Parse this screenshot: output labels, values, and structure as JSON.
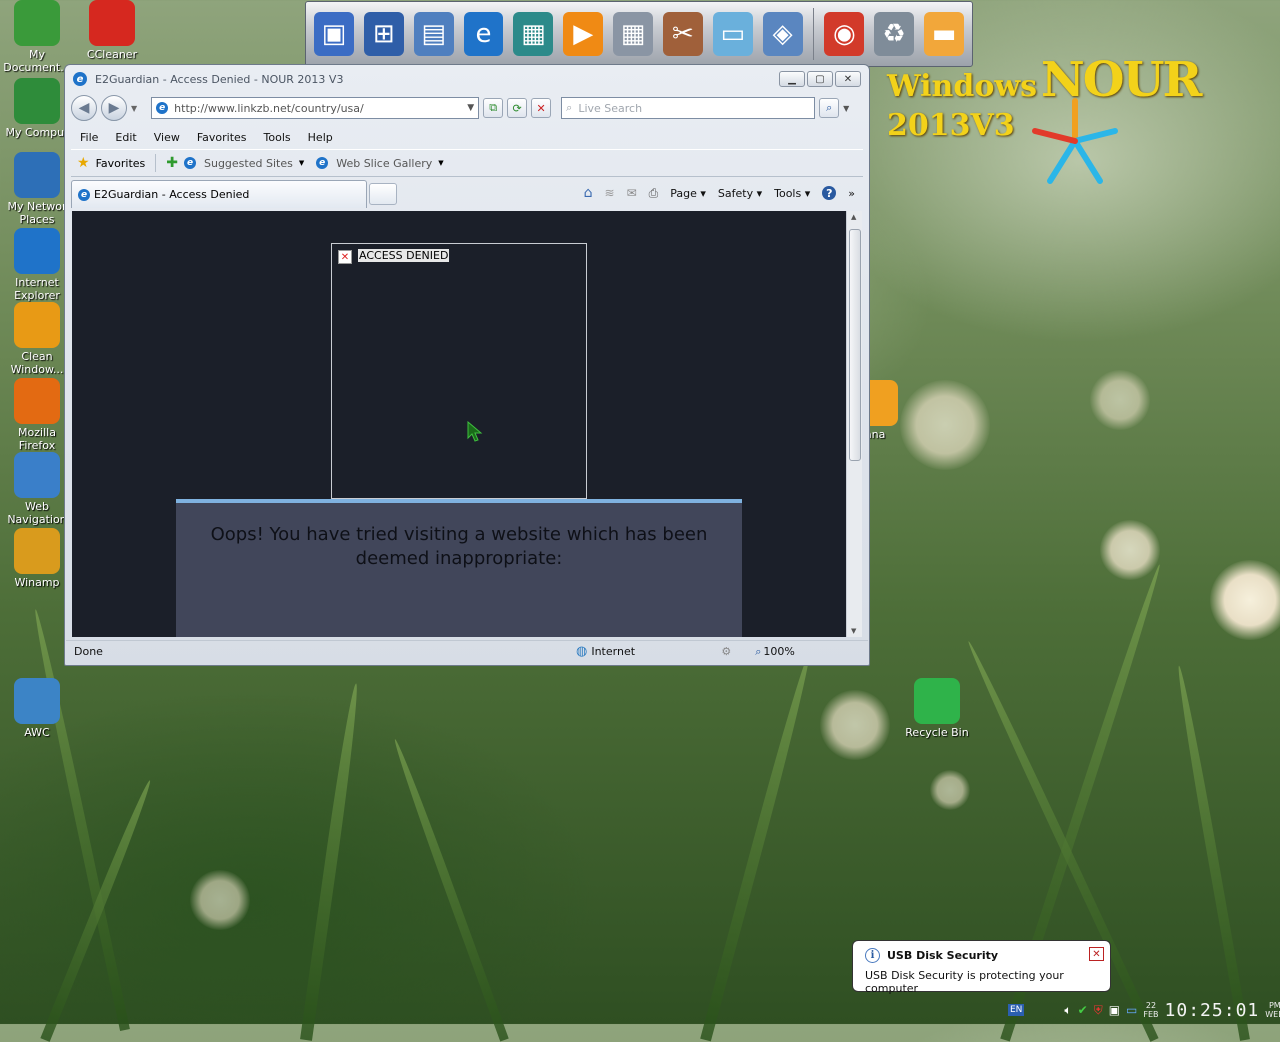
{
  "desktop": {
    "brand": {
      "word1": "Windows",
      "word2": "NOUR",
      "word3": "2013V3"
    },
    "icons": [
      {
        "label": "My Document...",
        "icon": "folder-documents-icon",
        "color": "#3a9a3a"
      },
      {
        "label": "CCleaner",
        "icon": "ccleaner-icon",
        "color": "#d6281f"
      },
      {
        "label": "My Comput",
        "icon": "computer-icon",
        "color": "#2e8c3a"
      },
      {
        "label": "My Networ Places",
        "icon": "network-icon",
        "color": "#2d6fb7"
      },
      {
        "label": "Internet Explorer",
        "icon": "ie-icon",
        "color": "#1f73c9"
      },
      {
        "label": "Clean Window...",
        "icon": "broom-icon",
        "color": "#e89a15"
      },
      {
        "label": "Mozilla Firefox",
        "icon": "firefox-icon",
        "color": "#e36a12"
      },
      {
        "label": "Web Navigation",
        "icon": "globe-icon",
        "color": "#3a7fc9"
      },
      {
        "label": "Winamp",
        "icon": "winamp-icon",
        "color": "#d99b1d"
      },
      {
        "label": "AWC",
        "icon": "awc-icon",
        "color": "#3c84c6"
      },
      {
        "label": "Recycle Bin",
        "icon": "recycle-bin-icon",
        "color": "#2fb34a"
      },
      {
        "label": "nna",
        "icon": "folder-icon",
        "color": "#f0a020"
      }
    ],
    "launchbar": [
      {
        "icon": "monitor-icon",
        "glyph": "▣",
        "color": "#3b6cc4"
      },
      {
        "icon": "network-computers-icon",
        "glyph": "⊞",
        "color": "#2f5ea8"
      },
      {
        "icon": "documents-icon",
        "glyph": "▤",
        "color": "#4f7fbf"
      },
      {
        "icon": "ie-icon",
        "glyph": "e",
        "color": "#1f73c9"
      },
      {
        "icon": "display-settings-icon",
        "glyph": "▦",
        "color": "#2c8a8a"
      },
      {
        "icon": "media-player-icon",
        "glyph": "▶",
        "color": "#f08a14"
      },
      {
        "icon": "calculator-icon",
        "glyph": "▦",
        "color": "#8a95a4"
      },
      {
        "icon": "tools-icon",
        "glyph": "✂",
        "color": "#a0603a"
      },
      {
        "icon": "notepad-icon",
        "glyph": "▭",
        "color": "#6ab0dc"
      },
      {
        "icon": "control-panel-icon",
        "glyph": "◈",
        "color": "#5a86c0"
      },
      {
        "icon": "chrome-icon",
        "glyph": "◉",
        "color": "#d23a2a"
      },
      {
        "icon": "recycle-bin-icon",
        "glyph": "♻",
        "color": "#7f8c99"
      },
      {
        "icon": "folder-icon",
        "glyph": "▬",
        "color": "#f2a73a"
      }
    ]
  },
  "browser": {
    "title": "E2Guardian - Access Denied - NOUR 2013 V3",
    "address": "http://www.linkzb.net/country/usa/",
    "search_placeholder": "Live Search",
    "menu": [
      "File",
      "Edit",
      "View",
      "Favorites",
      "Tools",
      "Help"
    ],
    "favorites_label": "Favorites",
    "suggested_sites": "Suggested Sites",
    "web_slice_gallery": "Web Slice Gallery",
    "tab_title": "E2Guardian - Access Denied",
    "commands": {
      "page": "Page",
      "safety": "Safety",
      "tools": "Tools",
      "more": "»"
    },
    "content": {
      "image_alt": "ACCESS DENIED",
      "message": "Oops! You have tried visiting a website which has been deemed inappropriate:"
    },
    "status": {
      "left": "Done",
      "zone": "Internet",
      "zoom": "100%"
    }
  },
  "notification": {
    "title": "USB Disk Security",
    "message": "USB Disk Security is protecting your computer"
  },
  "tray": {
    "language": "EN",
    "date_day": "22",
    "date_month": "FEB",
    "time": "10:25:01",
    "ampm": "PM",
    "weekday": "WED"
  }
}
